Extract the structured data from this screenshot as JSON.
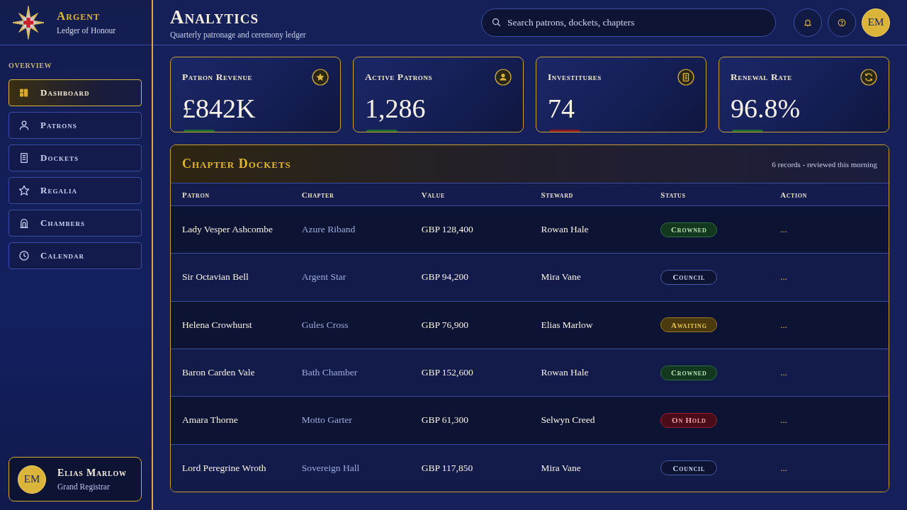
{
  "brand": {
    "name": "Argent",
    "tagline": "Ledger of Honour"
  },
  "sidebar": {
    "section": "OVERVIEW",
    "items": [
      {
        "label": "Dashboard",
        "selected": true
      },
      {
        "label": "Patrons",
        "selected": false
      },
      {
        "label": "Dockets",
        "selected": false
      },
      {
        "label": "Regalia",
        "selected": false
      },
      {
        "label": "Chambers",
        "selected": false
      },
      {
        "label": "Calendar",
        "selected": false
      }
    ],
    "user": {
      "initials": "EM",
      "name": "Elias Marlow",
      "role": "Grand Registrar"
    }
  },
  "header": {
    "title": "Analytics",
    "subtitle": "Quarterly patronage and ceremony ledger",
    "search": {
      "placeholder": "Search patrons, dockets, chapters"
    },
    "avatar": "EM"
  },
  "kpis": [
    {
      "label": "Patron Revenue",
      "value": "£842K",
      "color": "#1c6b33"
    },
    {
      "label": "Active Patrons",
      "value": "1,286",
      "color": "#1c6b33"
    },
    {
      "label": "Investitures",
      "value": "74",
      "color": "#8c1622"
    },
    {
      "label": "Renewal Rate",
      "value": "96.8%",
      "color": "#1c6b33"
    }
  ],
  "table": {
    "title": "Chapter Dockets",
    "note": "6 records - reviewed this morning",
    "columns": [
      "Patron",
      "Chapter",
      "Value",
      "Steward",
      "Status",
      "Action"
    ],
    "rows": [
      {
        "patron": "Lady Vesper Ashcombe",
        "chapter": "Azure Riband",
        "value": "GBP 128,400",
        "steward": "Rowan Hale",
        "status": {
          "label": "Crowned",
          "kind": "success"
        },
        "action": "..."
      },
      {
        "patron": "Sir Octavian Bell",
        "chapter": "Argent Star",
        "value": "GBP 94,200",
        "steward": "Mira Vane",
        "status": {
          "label": "Council",
          "kind": "neutral"
        },
        "action": "..."
      },
      {
        "patron": "Helena Crowhurst",
        "chapter": "Gules Cross",
        "value": "GBP 76,900",
        "steward": "Elias Marlow",
        "status": {
          "label": "Awaiting",
          "kind": "warning"
        },
        "action": "..."
      },
      {
        "patron": "Baron Carden Vale",
        "chapter": "Bath Chamber",
        "value": "GBP 152,600",
        "steward": "Rowan Hale",
        "status": {
          "label": "Crowned",
          "kind": "success"
        },
        "action": "..."
      },
      {
        "patron": "Amara Thorne",
        "chapter": "Motto Garter",
        "value": "GBP 61,300",
        "steward": "Selwyn Creed",
        "status": {
          "label": "On Hold",
          "kind": "danger"
        },
        "action": "..."
      },
      {
        "patron": "Lord Peregrine Wroth",
        "chapter": "Sovereign Hall",
        "value": "GBP 117,850",
        "steward": "Mira Vane",
        "status": {
          "label": "Council",
          "kind": "neutral"
        },
        "action": "..."
      }
    ]
  }
}
